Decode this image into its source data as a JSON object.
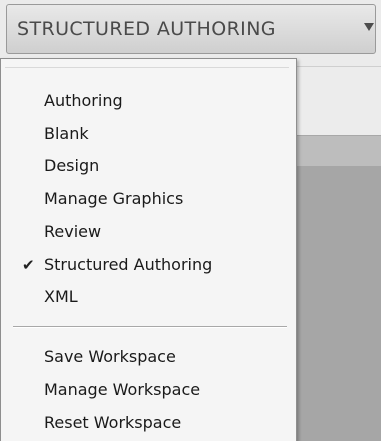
{
  "switcher": {
    "label": "STRUCTURED AUTHORING",
    "arrow_icon": "chevron-down-icon"
  },
  "menu": {
    "workspaces": [
      {
        "label": "Authoring",
        "checked": false
      },
      {
        "label": "Blank",
        "checked": false
      },
      {
        "label": "Design",
        "checked": false
      },
      {
        "label": "Manage Graphics",
        "checked": false
      },
      {
        "label": "Review",
        "checked": false
      },
      {
        "label": "Structured Authoring",
        "checked": true
      },
      {
        "label": "XML",
        "checked": false
      }
    ],
    "actions": [
      {
        "label": "Save Workspace"
      },
      {
        "label": "Manage Workspace"
      },
      {
        "label": "Reset Workspace"
      }
    ],
    "check_glyph": "✔"
  }
}
